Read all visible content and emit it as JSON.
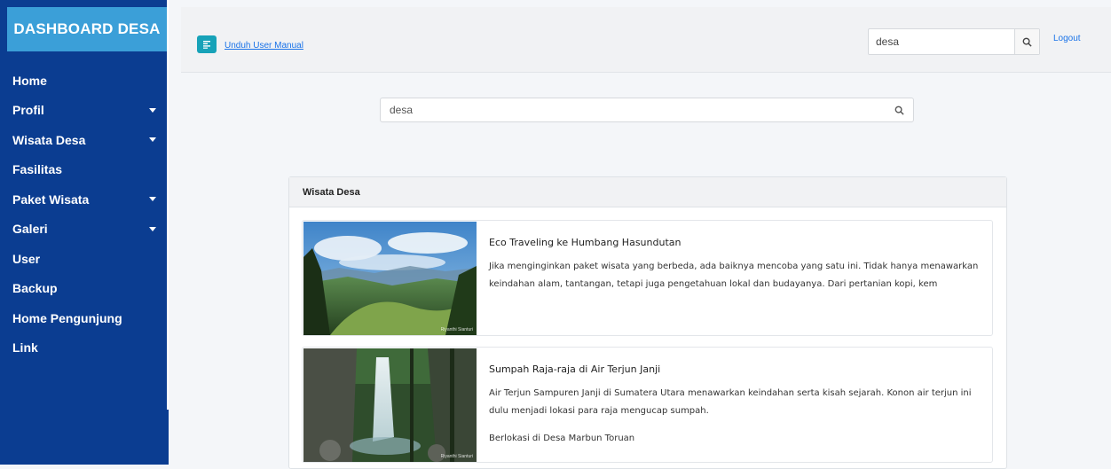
{
  "sidebar": {
    "brand": "DASHBOARD DESA",
    "items": [
      {
        "label": "Home",
        "has_caret": false
      },
      {
        "label": "Profil",
        "has_caret": true
      },
      {
        "label": "Wisata Desa",
        "has_caret": true
      },
      {
        "label": "Fasilitas",
        "has_caret": false
      },
      {
        "label": "Paket Wisata",
        "has_caret": true
      },
      {
        "label": "Galeri",
        "has_caret": true
      },
      {
        "label": "User",
        "has_caret": false
      },
      {
        "label": "Backup",
        "has_caret": false
      },
      {
        "label": "Home Pengunjung",
        "has_caret": false
      },
      {
        "label": "Link",
        "has_caret": false
      }
    ]
  },
  "topbar": {
    "manual_link": "Unduh User Manual",
    "search_value": "desa",
    "logout": "Logout"
  },
  "main": {
    "search_value": "desa",
    "card_title": "Wisata Desa",
    "results": [
      {
        "title": "Eco Traveling ke Humbang Hasundutan",
        "text": "Jika menginginkan paket wisata yang berbeda, ada baiknya mencoba yang satu ini. Tidak hanya menawarkan keindahan alam, tantangan, tetapi juga pengetahuan lokal dan budayanya. Dari pertanian kopi, kem",
        "extra": "",
        "image_credit": "Riyanthi Sianturi"
      },
      {
        "title": "Sumpah Raja-raja di Air Terjun Janji",
        "text": "Air Terjun Sampuren Janji di Sumatera Utara menawarkan keindahan serta kisah sejarah. Konon air terjun ini dulu menjadi lokasi para raja mengucap sumpah.",
        "extra": "Berlokasi di Desa Marbun Toruan",
        "image_credit": "Riyanthi Sianturi"
      }
    ]
  },
  "colors": {
    "sidebar_bg": "#0b3d91",
    "brand_bg": "#3b9fd8",
    "manual_btn": "#17a2b8",
    "link": "#1a73e8"
  },
  "icons": {
    "manual": "list-icon",
    "search": "search-icon",
    "caret": "caret-down-icon"
  }
}
